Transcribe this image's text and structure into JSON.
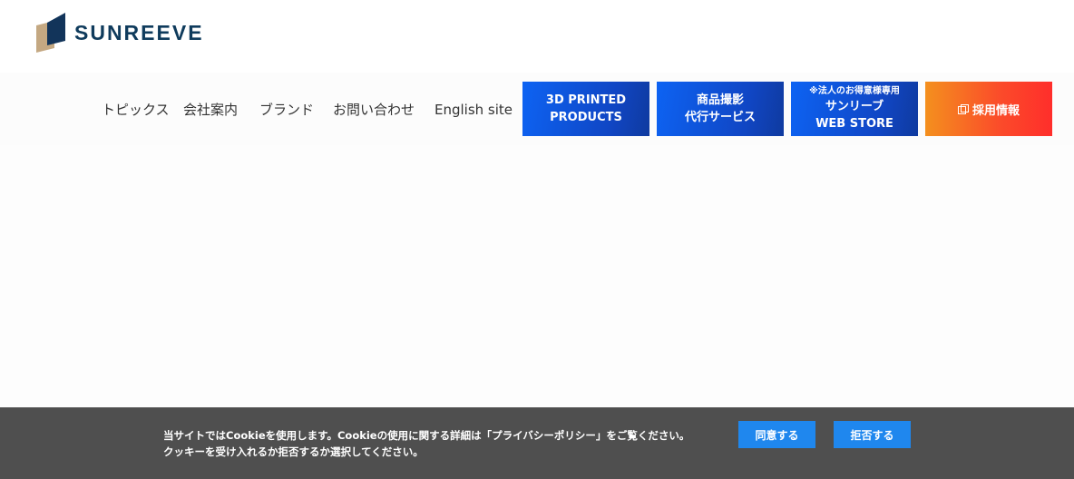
{
  "brand": {
    "name": "SUNREEVE",
    "colors": {
      "navy": "#0f3b5c",
      "tan": "#c4a882",
      "dark": "#12345a"
    }
  },
  "nav": {
    "links": [
      "トピックス",
      "会社案内",
      "ブランド",
      "お問い合わせ",
      "English site"
    ],
    "buttons": {
      "printed": [
        "3D PRINTED",
        "PRODUCTS"
      ],
      "photo": [
        "商品撮影",
        "代行サービス"
      ],
      "store": {
        "note": "※法人のお得意様専用",
        "lines": [
          "サンリーブ",
          "WEB STORE"
        ]
      },
      "recruit": {
        "icon": "external-link-icon",
        "label": "採用情報"
      }
    },
    "colors": {
      "blue_start": "#0d63f3",
      "blue_end": "#0f3a9f",
      "orange_start": "#f4901e",
      "orange_end": "#ff2e2b"
    }
  },
  "cookie": {
    "line1": "当サイトではCookieを使用します。Cookieの使用に関する詳細は「プライバシーポリシー」をご覧ください。",
    "line2": "クッキーを受け入れるか拒否するか選択してください。",
    "accept": "同意する",
    "reject": "拒否する",
    "colors": {
      "bar": "#4f4f4f",
      "button": "#1f87ee"
    }
  }
}
